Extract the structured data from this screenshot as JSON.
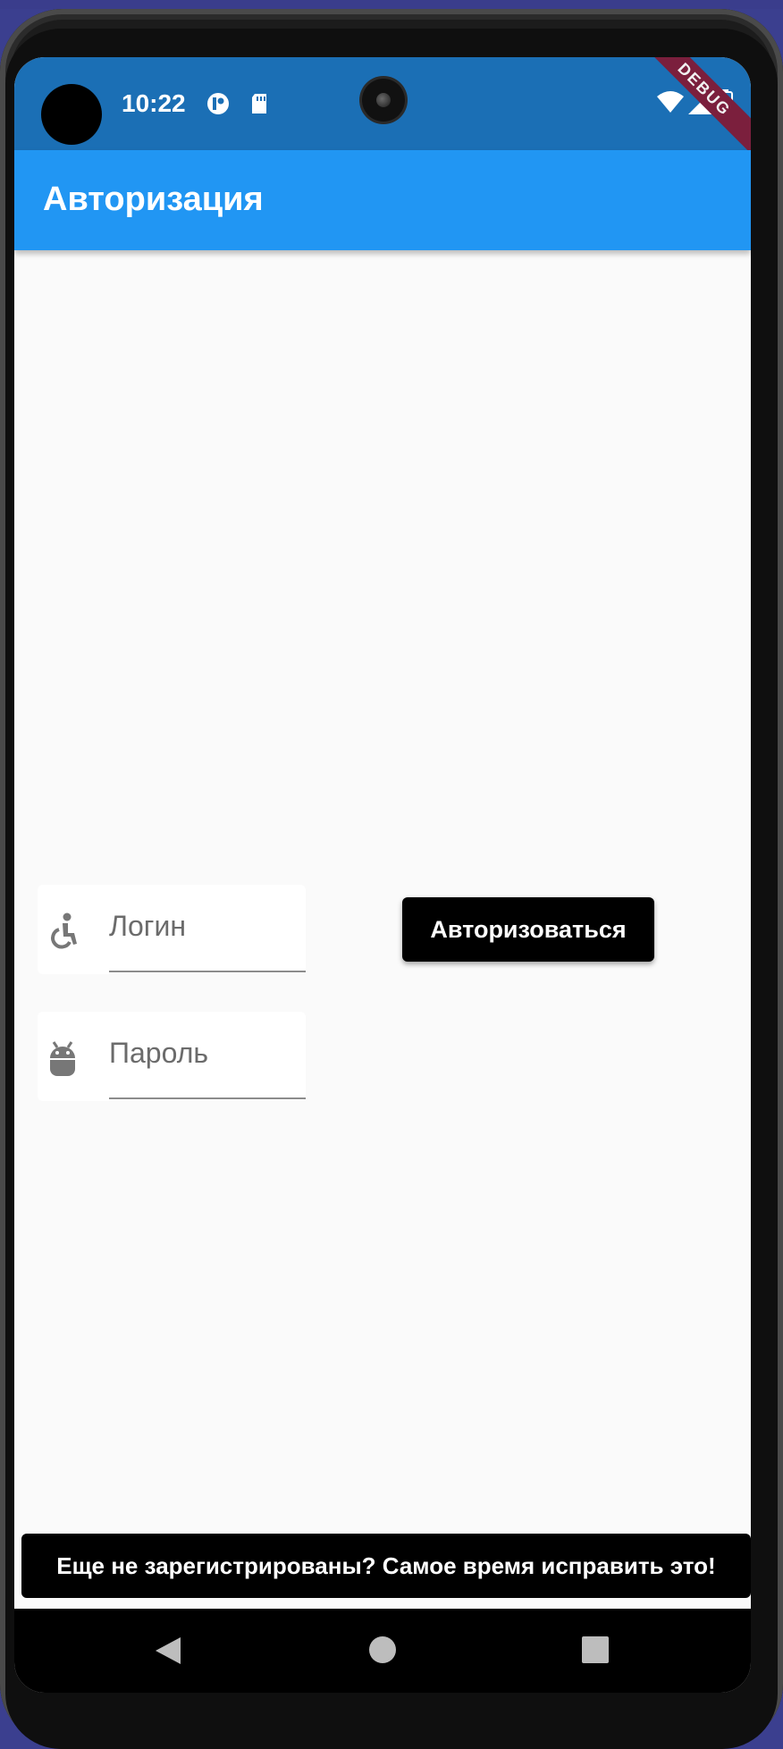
{
  "status_bar": {
    "time": "10:22",
    "icons": [
      "notification-icon",
      "sd-card-icon",
      "wifi-icon",
      "signal-icon",
      "battery-icon"
    ]
  },
  "debug_banner": "DEBUG",
  "app_bar": {
    "title": "Авторизация"
  },
  "form": {
    "login": {
      "placeholder": "Логин",
      "value": "",
      "icon": "accessible-icon"
    },
    "password": {
      "placeholder": "Пароль",
      "value": "",
      "icon": "android-icon"
    },
    "submit_label": "Авторизоваться"
  },
  "register_prompt": "Еще не зарегистрированы? Самое время исправить это!",
  "nav": [
    "back-icon",
    "home-icon",
    "recents-icon"
  ],
  "colors": {
    "status_bar": "#1b6fb5",
    "app_bar": "#2196f3",
    "background": "#fafafa",
    "button": "#000000",
    "debug_ribbon": "#7b1f3d"
  }
}
